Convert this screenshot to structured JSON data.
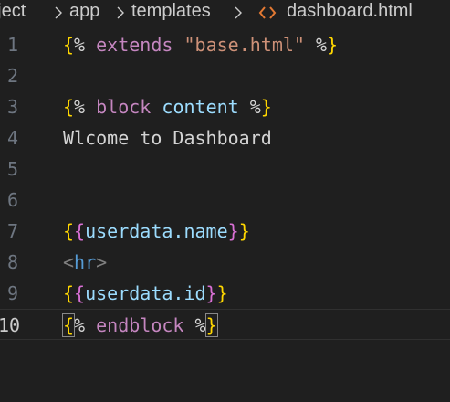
{
  "breadcrumb": {
    "project": "oject",
    "app": "app",
    "templates": "templates",
    "file": "dashboard.html",
    "file_icon": "html-file-icon"
  },
  "editor": {
    "current_line": 10,
    "lines": [
      {
        "number": "1",
        "tokens": [
          {
            "t": "{",
            "c": "tok-brace"
          },
          {
            "t": "% ",
            "c": "tok-plain"
          },
          {
            "t": "extends",
            "c": "tok-kw"
          },
          {
            "t": " ",
            "c": "tok-plain"
          },
          {
            "t": "\"base.html\"",
            "c": "tok-str"
          },
          {
            "t": " %",
            "c": "tok-plain"
          },
          {
            "t": "}",
            "c": "tok-brace"
          }
        ]
      },
      {
        "number": "2",
        "tokens": []
      },
      {
        "number": "3",
        "tokens": [
          {
            "t": "{",
            "c": "tok-brace"
          },
          {
            "t": "% ",
            "c": "tok-plain"
          },
          {
            "t": "block",
            "c": "tok-kw"
          },
          {
            "t": " ",
            "c": "tok-plain"
          },
          {
            "t": "content",
            "c": "tok-content"
          },
          {
            "t": " %",
            "c": "tok-plain"
          },
          {
            "t": "}",
            "c": "tok-brace"
          }
        ]
      },
      {
        "number": "4",
        "tokens": [
          {
            "t": "Wlcome to Dashboard",
            "c": "tok-plain"
          }
        ]
      },
      {
        "number": "5",
        "tokens": []
      },
      {
        "number": "6",
        "tokens": []
      },
      {
        "number": "7",
        "tokens": [
          {
            "t": "{",
            "c": "tok-brace"
          },
          {
            "t": "{",
            "c": "tok-brace2"
          },
          {
            "t": "userdata.name",
            "c": "tok-name"
          },
          {
            "t": "}",
            "c": "tok-brace2"
          },
          {
            "t": "}",
            "c": "tok-brace"
          }
        ]
      },
      {
        "number": "8",
        "tokens": [
          {
            "t": "<",
            "c": "tok-tag"
          },
          {
            "t": "hr",
            "c": "tok-tagname"
          },
          {
            "t": ">",
            "c": "tok-tag"
          }
        ]
      },
      {
        "number": "9",
        "tokens": [
          {
            "t": "{",
            "c": "tok-brace"
          },
          {
            "t": "{",
            "c": "tok-brace2"
          },
          {
            "t": "userdata.id",
            "c": "tok-name"
          },
          {
            "t": "}",
            "c": "tok-brace2"
          },
          {
            "t": "}",
            "c": "tok-brace"
          }
        ]
      },
      {
        "number": "10",
        "tokens": [
          {
            "t": "{",
            "c": "tok-brace bracket-match"
          },
          {
            "t": "% ",
            "c": "tok-plain"
          },
          {
            "t": "endblock",
            "c": "tok-kw"
          },
          {
            "t": " %",
            "c": "tok-plain"
          },
          {
            "t": "}",
            "c": "tok-brace bracket-match"
          }
        ]
      }
    ]
  }
}
